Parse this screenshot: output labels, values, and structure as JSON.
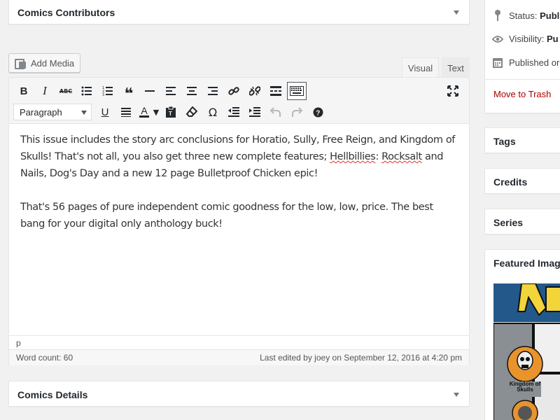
{
  "contributors": {
    "title": "Comics Contributors"
  },
  "add_media": {
    "label": "Add Media"
  },
  "tabs": {
    "visual": "Visual",
    "text": "Text"
  },
  "toolbar": {
    "format_select": "Paragraph",
    "row1": [
      {
        "name": "bold-button",
        "glyph": "B"
      },
      {
        "name": "italic-button",
        "glyph": "I"
      },
      {
        "name": "strikethrough-button",
        "glyph": "ABC"
      },
      {
        "name": "bulleted-list-button",
        "glyph": "☰"
      },
      {
        "name": "numbered-list-button",
        "glyph": "☷"
      },
      {
        "name": "blockquote-button",
        "glyph": "❝"
      },
      {
        "name": "horizontal-line-button",
        "glyph": "—"
      },
      {
        "name": "align-left-button",
        "glyph": "≡"
      },
      {
        "name": "align-center-button",
        "glyph": "≡"
      },
      {
        "name": "align-right-button",
        "glyph": "≡"
      },
      {
        "name": "insert-link-button",
        "glyph": "🔗"
      },
      {
        "name": "remove-link-button",
        "glyph": "⛓"
      },
      {
        "name": "read-more-button",
        "glyph": "▬"
      },
      {
        "name": "toolbar-toggle-button",
        "glyph": "⌨"
      }
    ],
    "row2": [
      {
        "name": "underline-button",
        "glyph": "U"
      },
      {
        "name": "justify-button",
        "glyph": "≣"
      },
      {
        "name": "text-color-button",
        "glyph": "A"
      },
      {
        "name": "text-color-dropdown-button",
        "glyph": "▾"
      },
      {
        "name": "paste-as-text-button",
        "glyph": "📋"
      },
      {
        "name": "clear-formatting-button",
        "glyph": "⌫"
      },
      {
        "name": "special-character-button",
        "glyph": "Ω"
      },
      {
        "name": "outdent-button",
        "glyph": "⇤"
      },
      {
        "name": "indent-button",
        "glyph": "⇥"
      },
      {
        "name": "undo-button",
        "glyph": "↶"
      },
      {
        "name": "redo-button",
        "glyph": "↷"
      },
      {
        "name": "help-button",
        "glyph": "?"
      }
    ]
  },
  "content": {
    "p1_a": "This issue includes the story arc conclusions for Horatio, Sully, Free Reign, and Kingdom of Skulls! That's not all, you also get three new complete features; ",
    "p1_spell1": "Hellbillies",
    "p1_b": ": ",
    "p1_spell2": "Rocksalt",
    "p1_c": " and Nails, Dog's Day and a new 12 page Bulletproof Chicken epic!",
    "p2": "That's 56 pages of pure independent comic goodness for the low, low, price. The best bang for your digital only anthology buck!"
  },
  "editor": {
    "path": "p",
    "word_count": "Word count: 60",
    "last_edited": "Last edited by joey on September 12, 2016 at 4:20 pm"
  },
  "details": {
    "title": "Comics Details"
  },
  "publish": {
    "status_label": "Status: ",
    "status_value": "Publi",
    "visibility_label": "Visibility: ",
    "visibility_value": "Pu",
    "published_label": "Published or",
    "trash": "Move to Trash"
  },
  "sidebar": {
    "tags": "Tags",
    "credits": "Credits",
    "series": "Series",
    "featured": "Featured Image"
  },
  "featured_image": {
    "logo_text": "Kingdom of Skulls",
    "colors": {
      "sky": "#23588a",
      "yellow": "#f2d43b",
      "orange": "#e8932b",
      "gray": "#8a8f94"
    }
  }
}
